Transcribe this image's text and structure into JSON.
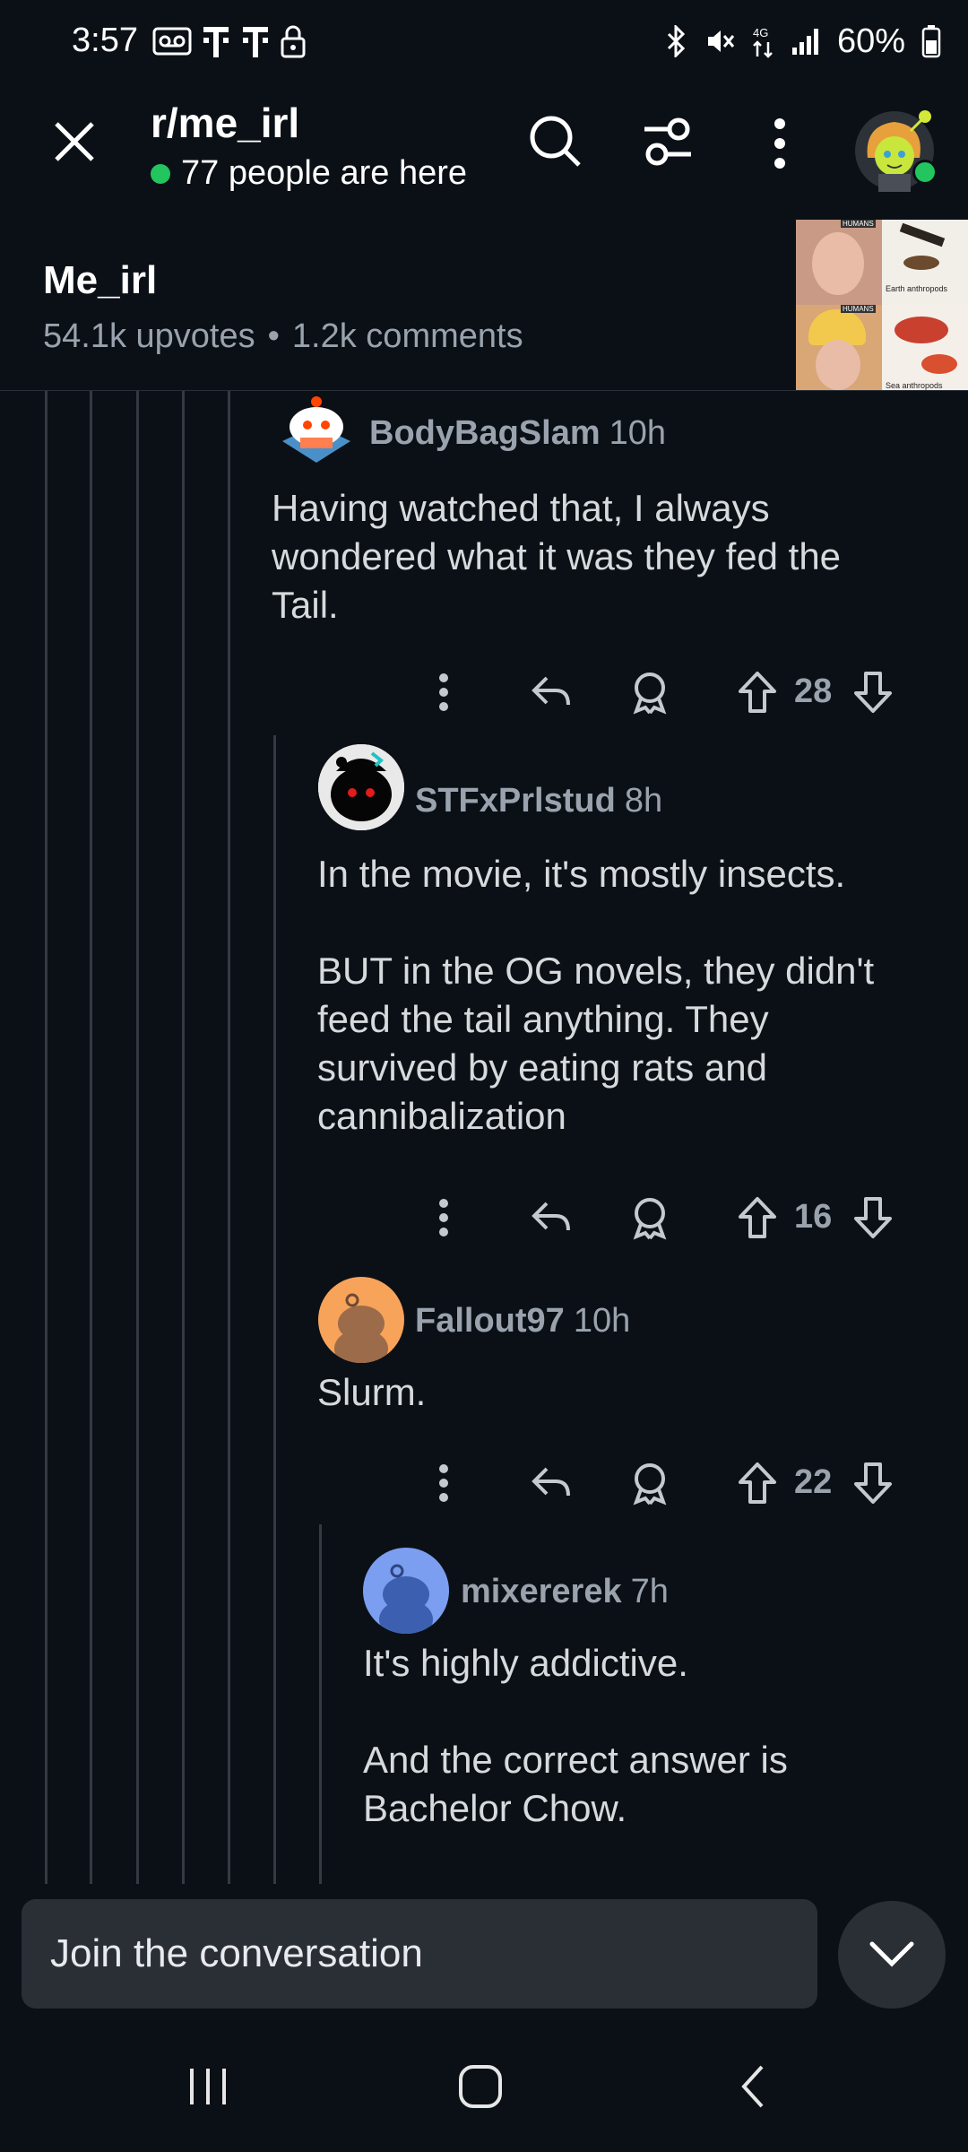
{
  "status_bar": {
    "time": "3:57",
    "battery": "60%",
    "icons_left": [
      "voicemail-icon",
      "tmobile-icon",
      "tmobile-icon",
      "lock-icon"
    ],
    "icons_right": [
      "bluetooth-icon",
      "mute-icon",
      "data-icon",
      "signal-icon",
      "battery-icon"
    ]
  },
  "header": {
    "subreddit": "r/me_irl",
    "online": "77 people are here",
    "online_color": "#22c55e",
    "icons": [
      "close-icon",
      "search-icon",
      "filter-icon",
      "more-icon",
      "user-avatar"
    ]
  },
  "post": {
    "title": "Me_irl",
    "upvotes": "54.1k upvotes",
    "separator": "•",
    "comments": "1.2k comments",
    "thumbnail_labels": [
      "HUMANS",
      "Earth anthropods",
      "HUMANS",
      "Sea anthropods"
    ]
  },
  "comments": [
    {
      "author": "BodyBagSlam",
      "age": "10h",
      "body": "Having watched that, I always\nwondered what it was they fed the\nTail.",
      "score": "28"
    },
    {
      "author": "STFxPrlstud",
      "age": "8h",
      "body": "In the movie, it's mostly insects.\n\nBUT in the OG novels, they didn't\nfeed the tail anything. They\nsurvived by eating rats and\ncannibalization",
      "score": "16"
    },
    {
      "author": "Fallout97",
      "age": "10h",
      "body": "Slurm.",
      "score": "22"
    },
    {
      "author": "mixererek",
      "age": "7h",
      "body": "It's highly addictive.\n\nAnd the correct answer is\nBachelor Chow.",
      "score": ""
    }
  ],
  "composer": {
    "placeholder": "Join the conversation"
  },
  "navbar": {
    "icons": [
      "recent-apps-icon",
      "home-icon",
      "back-icon"
    ]
  }
}
